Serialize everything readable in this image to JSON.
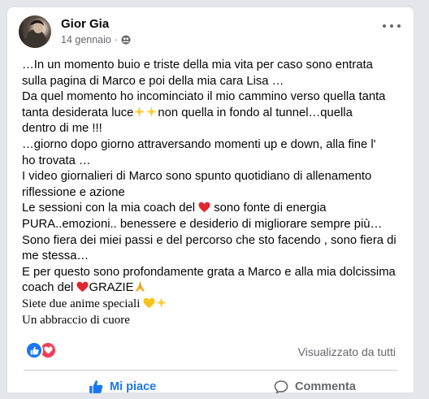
{
  "post": {
    "author": "Gior Gia",
    "date": "14 gennaio",
    "separator": "·",
    "privacy_icon": "friends-icon"
  },
  "text": {
    "l1": "…In un momento buio e triste della mia vita per caso sono entrata",
    "l2": "sulla pagina di Marco e poi della mia cara Lisa …",
    "l3": "Da quel momento ho incominciato il mio cammino verso  quella tanta",
    "l4a": "tanta  desiderata  luce",
    "l4b": "non quella in fondo al tunnel…quella",
    "l5": "dentro di me !!!",
    "l6": " …giorno dopo giorno attraversando momenti up e down,  alla fine l'",
    "l7": "ho trovata …",
    "l8": "I video giornalieri di Marco sono spunto quotidiano di allenamento",
    "l9": "riflessione e azione",
    "l10a": " Le sessioni con la mia coach del ",
    "l10b": " sono fonte di energia",
    "l11": "PURA..emozioni.. benessere e desiderio di migliorare sempre più…",
    "l12": "Sono fiera dei miei passi e del percorso che sto facendo , sono fiera di",
    "l13": "me stessa…",
    "l14": "E per questo sono profondamente grata a Marco  e alla mia dolcissima",
    "l15a": "coach del ",
    "l15b": "GRAZIE",
    "l16": "Siete due anime speciali ",
    "l17": "Un abbraccio di cuore"
  },
  "emoji": {
    "sparkles": "sparkles-icon",
    "heart": "red-heart-icon",
    "pray": "folded-hands-icon",
    "yellow_heart": "yellow-heart-icon"
  },
  "footer": {
    "reactions": [
      "like-reaction-icon",
      "love-reaction-icon"
    ],
    "seen_label": "Visualizzato da tutti",
    "like_label": "Mi piace",
    "comment_label": "Commenta"
  },
  "colors": {
    "accent": "#1877f2",
    "love": "#f33e58",
    "muted": "#65676b",
    "text": "#050505"
  }
}
